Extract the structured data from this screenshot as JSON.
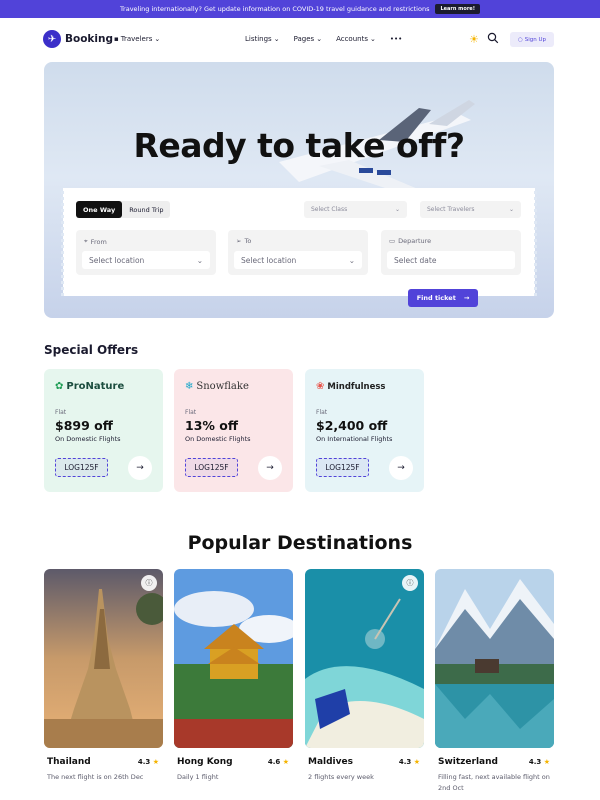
{
  "banner": {
    "text": "Traveling internationally? Get update information on COVID-19 travel guidance and restrictions",
    "link": "Learn more!"
  },
  "nav": {
    "brand": "Booking",
    "travelers": "Travelers",
    "links": [
      "Listings",
      "Pages",
      "Accounts",
      "•••"
    ],
    "signup": "Sign Up"
  },
  "hero": {
    "title": "Ready to take off?",
    "tabs": [
      "One Way",
      "Round Trip"
    ],
    "select_class": "Select Class",
    "select_travelers": "Select Travelers",
    "from_label": "From",
    "from_value": "Select location",
    "to_label": "To",
    "to_value": "Select location",
    "departure_label": "Departure",
    "departure_value": "Select date",
    "find_button": "Find ticket"
  },
  "offers": {
    "title": "Special Offers",
    "items": [
      {
        "brand": "ProNature",
        "flat": "Flat",
        "price": "$899 off",
        "desc": "On Domestic Flights",
        "code": "LOG125F",
        "bg": "#e6f6ee"
      },
      {
        "brand": "Snowflake",
        "flat": "Flat",
        "price": "13% off",
        "desc": "On Domestic Flights",
        "code": "LOG125F",
        "bg": "#fbe6e8"
      },
      {
        "brand": "Mindfulness",
        "flat": "Flat",
        "price": "$2,400 off",
        "desc": "On International Flights",
        "code": "LOG125F",
        "bg": "#e6f4f7"
      }
    ]
  },
  "destinations": {
    "title": "Popular Destinations",
    "items": [
      {
        "name": "Thailand",
        "rating": "4.3",
        "sub": "The next flight is on 26th Dec"
      },
      {
        "name": "Hong Kong",
        "rating": "4.6",
        "sub": "Daily 1 flight"
      },
      {
        "name": "Maldives",
        "rating": "4.3",
        "sub": "2 flights every week"
      },
      {
        "name": "Switzerland",
        "rating": "4.3",
        "sub": "Filling fast, next available flight on 2nd Oct"
      }
    ]
  }
}
